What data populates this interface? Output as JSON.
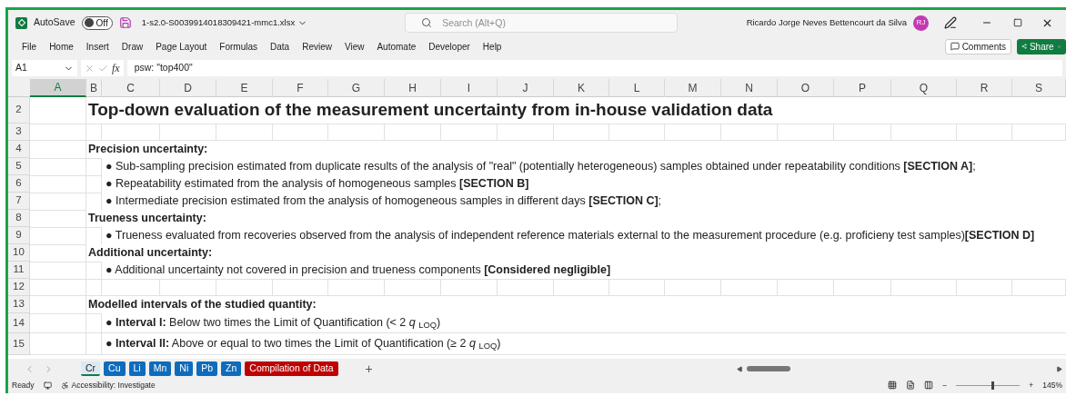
{
  "title_bar": {
    "autosave_label": "AutoSave",
    "autosave": {
      "on": false,
      "label": "Off"
    },
    "file_name": "1-s2.0-S0039914018309421-mmc1.xlsx",
    "search": {
      "placeholder": "Search (Alt+Q)"
    },
    "user_name": "Ricardo Jorge Neves Bettencourt da Silva",
    "avatar_initials": "RJ"
  },
  "menu": {
    "items": [
      "File",
      "Home",
      "Insert",
      "Draw",
      "Page Layout",
      "Formulas",
      "Data",
      "Review",
      "View",
      "Automate",
      "Developer",
      "Help"
    ],
    "comments_button": "Comments",
    "share_button": "Share"
  },
  "formula_bar": {
    "name_box": "A1",
    "fx": "fx",
    "value": "psw: \"top400\""
  },
  "columns": [
    {
      "label": "A",
      "selected": true
    },
    {
      "label": "B",
      "selected": false
    },
    {
      "label": "C",
      "selected": false
    },
    {
      "label": "D",
      "selected": false
    },
    {
      "label": "E",
      "selected": false
    },
    {
      "label": "F",
      "selected": false
    },
    {
      "label": "G",
      "selected": false
    },
    {
      "label": "H",
      "selected": false
    },
    {
      "label": "I",
      "selected": false
    },
    {
      "label": "J",
      "selected": false
    },
    {
      "label": "K",
      "selected": false
    },
    {
      "label": "L",
      "selected": false
    },
    {
      "label": "M",
      "selected": false
    },
    {
      "label": "N",
      "selected": false
    },
    {
      "label": "O",
      "selected": false
    },
    {
      "label": "P",
      "selected": false
    },
    {
      "label": "Q",
      "selected": false
    },
    {
      "label": "R",
      "selected": false
    },
    {
      "label": "S",
      "selected": false
    }
  ],
  "rows": [
    {
      "number": "2",
      "cells": [
        {
          "kind": "title",
          "text": "Top-down evaluation of the measurement uncertainty from  in-house validation data"
        }
      ]
    },
    {
      "number": "3",
      "cells": []
    },
    {
      "number": "4",
      "cells": [
        {
          "kind": "heading",
          "text": "Precision uncertainty:"
        }
      ]
    },
    {
      "number": "5",
      "cells": [
        {
          "kind": "bullet",
          "text": "● Sub-sampling precision estimated from duplicate results of the analysis of \"real\" (potentially heterogeneous) samples obtained under repeatability conditions **[SECTION A]**;"
        }
      ]
    },
    {
      "number": "6",
      "cells": [
        {
          "kind": "bullet",
          "text": "● Repeatability estimated from the analysis of homogeneous samples **[SECTION B]**"
        }
      ]
    },
    {
      "number": "7",
      "cells": [
        {
          "kind": "bullet",
          "text": "● Intermediate precision estimated from the analysis of homogeneous samples in different days **[SECTION C]**;"
        }
      ]
    },
    {
      "number": "8",
      "cells": [
        {
          "kind": "heading",
          "text": "Trueness uncertainty:"
        }
      ]
    },
    {
      "number": "9",
      "cells": [
        {
          "kind": "bullet",
          "text": "● Trueness evaluated from recoveries observed from the analysis of independent reference materials external to the measurement procedure (e.g. proficieny test samples)**[SECTION D]**"
        }
      ]
    },
    {
      "number": "10",
      "cells": [
        {
          "kind": "heading",
          "text": "Additional uncertainty:"
        }
      ]
    },
    {
      "number": "11",
      "cells": [
        {
          "kind": "bullet",
          "text": "● Additional uncertainty not covered in precision and trueness components **[Considered negligible]**"
        }
      ]
    },
    {
      "number": "12",
      "cells": []
    },
    {
      "number": "13",
      "cells": [
        {
          "kind": "heading",
          "text": "Modelled intervals of the studied quantity:"
        }
      ]
    },
    {
      "number": "14",
      "cells": [
        {
          "kind": "bullet",
          "text": "● **Interval I:** Below two times the Limit of Quantification (< 2 *q* $_{LOQ}$)"
        }
      ]
    },
    {
      "number": "15",
      "cells": [
        {
          "kind": "bullet",
          "text": "● **Interval II:** Above or equal to two times the Limit of Quantification (≥ 2 *q* $_{LOQ}$)"
        }
      ]
    }
  ],
  "sheet_tabs": [
    {
      "label": "Cr",
      "selected": true,
      "color": "#dbe8f5"
    },
    {
      "label": "Cu",
      "selected": false,
      "color": "#0f6cbd"
    },
    {
      "label": "Li",
      "selected": false,
      "color": "#0f6cbd"
    },
    {
      "label": "Mn",
      "selected": false,
      "color": "#0f6cbd"
    },
    {
      "label": "Ni",
      "selected": false,
      "color": "#0f6cbd"
    },
    {
      "label": "Pb",
      "selected": false,
      "color": "#0f6cbd"
    },
    {
      "label": "Zn",
      "selected": false,
      "color": "#0f6cbd"
    },
    {
      "label": "Compilation of Data",
      "selected": false,
      "color": "#c00000"
    }
  ],
  "add_sheet": "+",
  "status_bar": {
    "status": "Ready",
    "accessibility": "Accessibility: Investigate",
    "zoom": {
      "level": 0.55,
      "minus": "−",
      "plus": "+",
      "reading": "145%"
    }
  }
}
